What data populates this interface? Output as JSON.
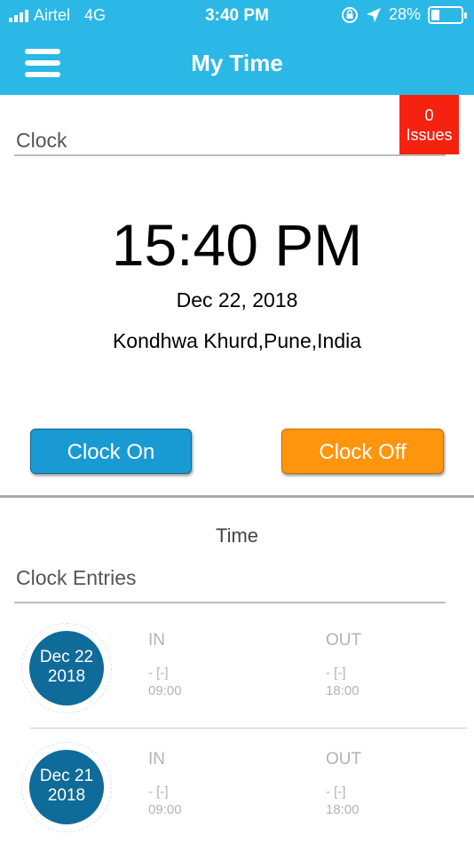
{
  "status_bar": {
    "carrier": "Airtel",
    "network": "4G",
    "time": "3:40 PM",
    "battery": "28%",
    "battery_level": 0.28
  },
  "nav": {
    "title": "My Time"
  },
  "issues": {
    "count": "0",
    "label": "Issues"
  },
  "clock": {
    "label": "Clock",
    "time": "15:40 PM",
    "date": "Dec 22, 2018",
    "location": "Kondhwa Khurd,Pune,India",
    "clock_on_label": "Clock On",
    "clock_off_label": "Clock Off"
  },
  "time_section": {
    "heading": "Time",
    "entries_label": "Clock Entries"
  },
  "entries": [
    {
      "month_day": "Dec 22",
      "year": "2018",
      "in_label": "IN",
      "in_value": "- [-]",
      "in_time": "09:00",
      "out_label": "OUT",
      "out_value": "- [-]",
      "out_time": "18:00"
    },
    {
      "month_day": "Dec 21",
      "year": "2018",
      "in_label": "IN",
      "in_value": "- [-]",
      "in_time": "09:00",
      "out_label": "OUT",
      "out_value": "- [-]",
      "out_time": "18:00"
    }
  ],
  "colors": {
    "header": "#2bb8e6",
    "issues_badge": "#f5220f",
    "clock_on": "#1a9ad3",
    "clock_off": "#ff950c",
    "date_circle": "#0f6b99"
  },
  "icons": [
    "signal-bars-icon",
    "rotation-lock-icon",
    "location-arrow-icon",
    "battery-icon",
    "hamburger-menu-icon"
  ]
}
